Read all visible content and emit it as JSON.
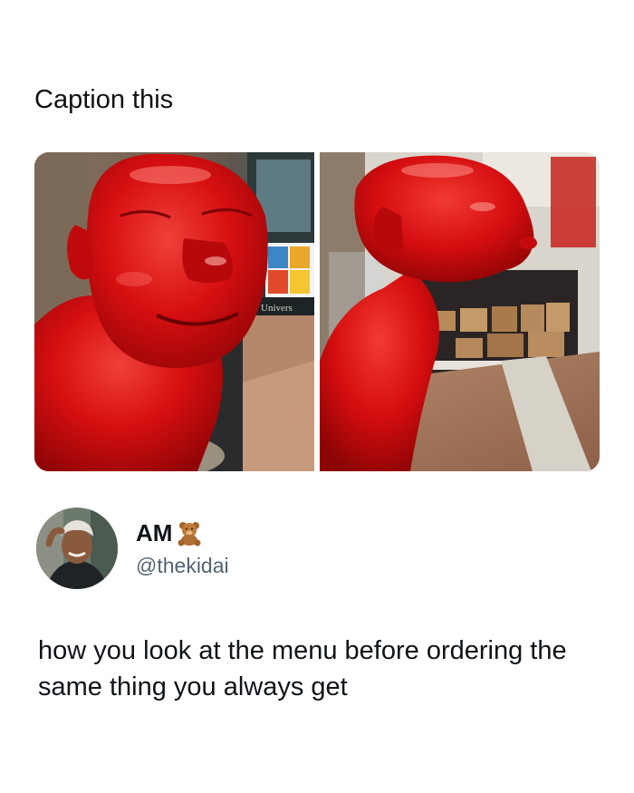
{
  "post": {
    "caption": "Caption this",
    "images": [
      {
        "icon": "red-statue-front-photo",
        "sign_text": "Univers"
      },
      {
        "icon": "red-statue-profile-photo"
      }
    ]
  },
  "tweet": {
    "author_name": "AM",
    "author_emoji": "teddy-bear-icon",
    "handle": "@thekidai",
    "text": "how you look at the menu before ordering the same thing you always get"
  },
  "colors": {
    "statue_red": "#d40d0f",
    "handle_gray": "#536471",
    "text": "#0f1419"
  }
}
